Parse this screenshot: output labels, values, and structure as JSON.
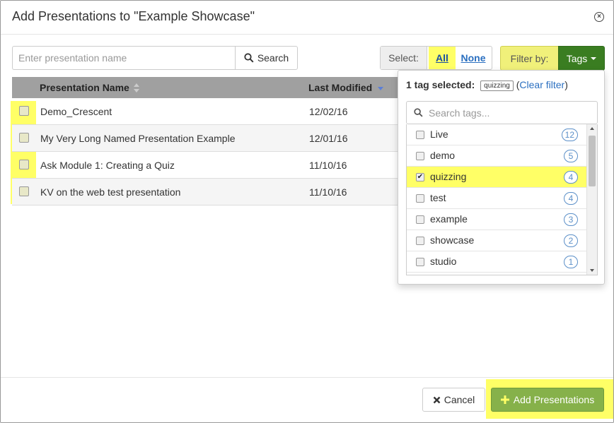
{
  "dialog": {
    "title": "Add Presentations to \"Example Showcase\"",
    "close_icon": "close-circle-icon"
  },
  "search": {
    "placeholder": "Enter presentation name",
    "value": "",
    "button_label": "Search",
    "icon": "search-icon"
  },
  "select": {
    "label": "Select:",
    "all": "All",
    "none": "None"
  },
  "filter": {
    "label": "Filter by:",
    "button_label": "Tags"
  },
  "table": {
    "columns": [
      "Presentation Name",
      "Last Modified"
    ],
    "rows": [
      {
        "name": "Demo_Crescent",
        "date": "12/02/16",
        "checked": false
      },
      {
        "name": "My Very Long Named Presentation Example",
        "date": "12/01/16",
        "checked": false
      },
      {
        "name": "Ask Module 1: Creating a Quiz",
        "date": "11/10/16",
        "checked": false
      },
      {
        "name": "KV on the web test presentation",
        "date": "11/10/16",
        "checked": false
      }
    ]
  },
  "tags_dropdown": {
    "count_text": "1 tag selected:",
    "selected_chip": "quizzing",
    "clear_open": "(",
    "clear_label": "Clear filter",
    "clear_close": ")",
    "search_placeholder": "Search tags...",
    "tags": [
      {
        "name": "Live",
        "count": "12",
        "checked": false
      },
      {
        "name": "demo",
        "count": "5",
        "checked": false
      },
      {
        "name": "quizzing",
        "count": "4",
        "checked": true
      },
      {
        "name": "test",
        "count": "4",
        "checked": false
      },
      {
        "name": "example",
        "count": "3",
        "checked": false
      },
      {
        "name": "showcase",
        "count": "2",
        "checked": false
      },
      {
        "name": "studio",
        "count": "1",
        "checked": false
      }
    ]
  },
  "footer": {
    "cancel_label": "Cancel",
    "add_label": "Add Presentations"
  },
  "colors": {
    "highlight": "#ffff66",
    "tags_button": "#3a7d21",
    "add_button": "#86b14a",
    "link": "#2a6fc0"
  }
}
